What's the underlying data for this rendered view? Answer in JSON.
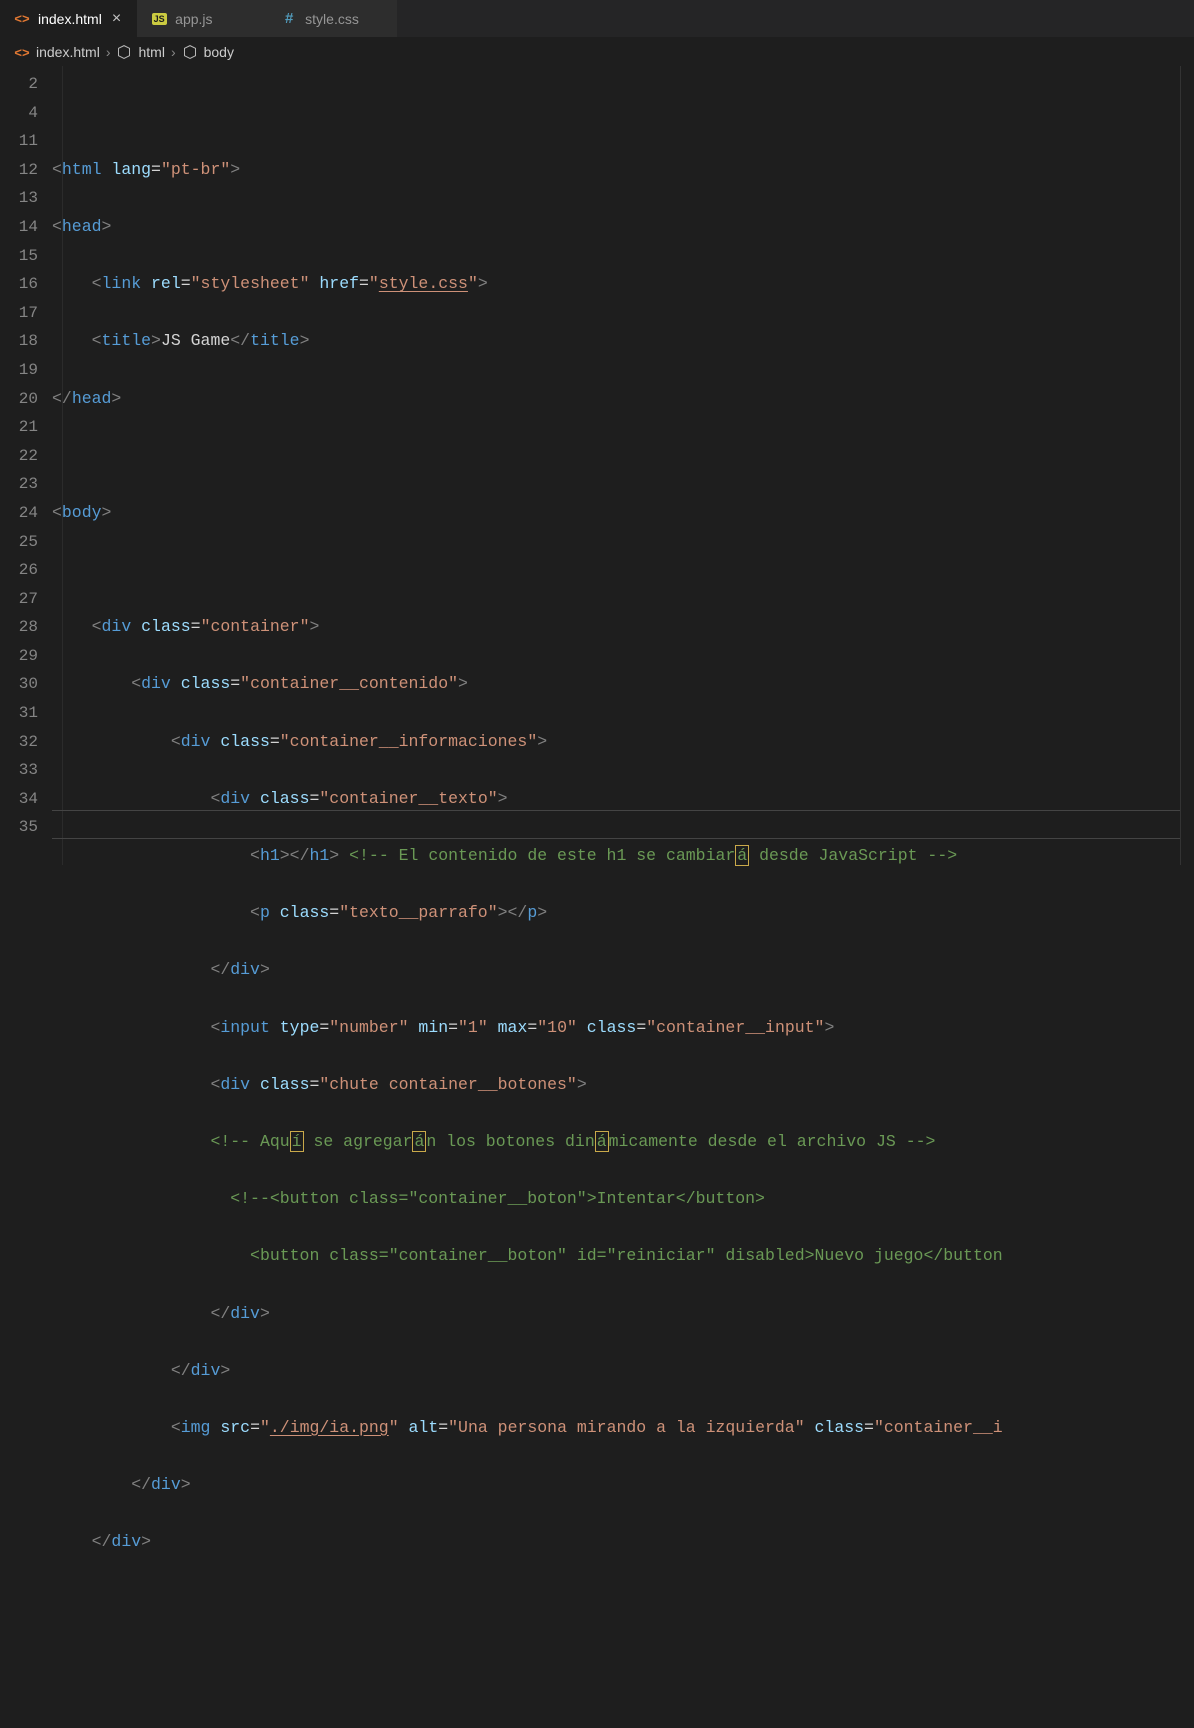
{
  "tabs": [
    {
      "name": "index.html",
      "icon": "html",
      "active": true
    },
    {
      "name": "app.js",
      "icon": "js",
      "active": false
    },
    {
      "name": "style.css",
      "icon": "css",
      "active": false
    }
  ],
  "breadcrumb": {
    "file": "index.html",
    "path1": "html",
    "path2": "body"
  },
  "lineNumbers": [
    "2",
    "4",
    "11",
    "12",
    "13",
    "14",
    "15",
    "16",
    "17",
    "18",
    "19",
    "20",
    "21",
    "22",
    "23",
    "24",
    "25",
    "26",
    "27",
    "28",
    "29",
    "30",
    "31",
    "32",
    "33",
    "34",
    "35"
  ],
  "code": {
    "l2": {
      "lang_attr": "lang",
      "lang_val": "\"pt-br\"",
      "tag": "html"
    },
    "l4": {
      "tag": "head"
    },
    "l11": {
      "tag": "link",
      "rel_attr": "rel",
      "rel_val": "\"stylesheet\"",
      "href_attr": "href",
      "href_val": "\"",
      "href_file": "style.css",
      "href_close": "\""
    },
    "l12": {
      "open": "title",
      "text": "JS Game",
      "close": "title"
    },
    "l13": {
      "tag": "head"
    },
    "l15": {
      "tag": "body"
    },
    "l17": {
      "tag": "div",
      "attr": "class",
      "val": "\"container\""
    },
    "l18": {
      "tag": "div",
      "attr": "class",
      "val": "\"container__contenido\""
    },
    "l19": {
      "tag": "div",
      "attr": "class",
      "val": "\"container__informaciones\""
    },
    "l20": {
      "tag": "div",
      "attr": "class",
      "val": "\"container__texto\""
    },
    "l21": {
      "open": "h1",
      "close": "h1",
      "comment_open": "<!--",
      "comment_text": " El contenido de este h1 se cambiar",
      "comment_boxed": "á",
      "comment_rest": " desde JavaScript ",
      "comment_close": "-->"
    },
    "l22": {
      "tag": "p",
      "attr": "class",
      "val": "\"texto__parrafo\"",
      "close": "p"
    },
    "l23": {
      "tag": "div"
    },
    "l24": {
      "tag": "input",
      "a1": "type",
      "v1": "\"number\"",
      "a2": "min",
      "v2": "\"1\"",
      "a3": "max",
      "v3": "\"10\"",
      "a4": "class",
      "v4": "\"container__input\""
    },
    "l25": {
      "tag": "div",
      "attr": "class",
      "val": "\"chute container__botones\""
    },
    "l26": {
      "open": "<!--",
      "t1": " Aqu",
      "b1": "í",
      "t2": " se agregar",
      "b2": "á",
      "t3": "n los botones din",
      "b3": "á",
      "t4": "micamente desde el archivo JS ",
      "close": "-->"
    },
    "l27": {
      "raw": "<!--<button class=\"container__boton\">Intentar</button>"
    },
    "l28": {
      "tag": "button",
      "a1": "class",
      "v1": "\"container__boton\"",
      "a2": "id",
      "v2": "\"reiniciar\"",
      "a3": "disabled",
      "text": "Nuevo juego",
      "close": "button"
    },
    "l29": {
      "tag": "div"
    },
    "l30": {
      "tag": "div"
    },
    "l31": {
      "tag": "img",
      "a1": "src",
      "v1q": "\"",
      "v1f": "./img/ia.png",
      "v1c": "\"",
      "a2": "alt",
      "v2": "\"Una persona mirando a la izquierda\"",
      "a3": "class",
      "v3": "\"container__i"
    },
    "l32": {
      "tag": "div"
    },
    "l33": {
      "tag": "div"
    }
  }
}
